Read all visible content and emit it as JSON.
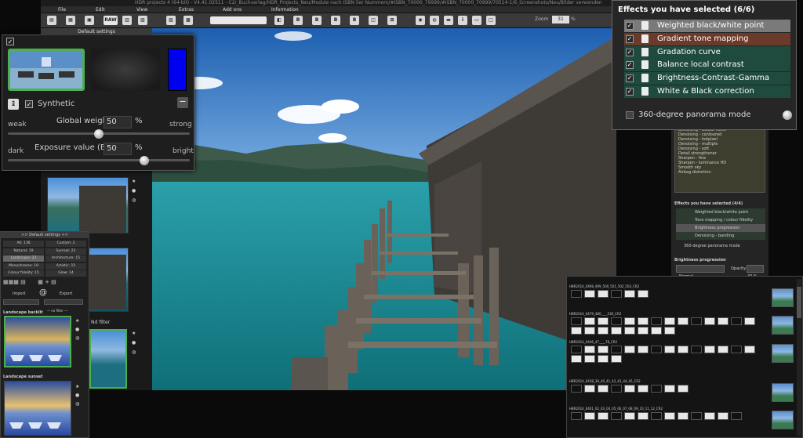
{
  "window": {
    "title": "HDR projects 4 (64-bit) - V4.41.02511 - C2/_Buchverlag/HDR_Projects_Neu/Module nach ISBN 5er Nummern/#ISBN_70000_79999/#ISBN_70000_70999/70514-1/6_Screenshots/Neu/Bilder verwenden"
  },
  "menu": {
    "file": "File",
    "edit": "Edit",
    "view": "View",
    "extras": "Extras",
    "addons": "Add ons",
    "information": "Information"
  },
  "toolbar": {
    "raw": "RAW",
    "zoom_label": "Zoom",
    "zoom_value": "31",
    "zoom_unit": "%"
  },
  "default_settings": {
    "header": "Default settings",
    "synthetic_label": "Synthetic",
    "global_weight": {
      "label": "Global weight",
      "value": "50",
      "unit": "%",
      "left": "weak",
      "right": "strong",
      "level": 0.5
    },
    "exposure": {
      "label": "Exposure value (EV)",
      "value": "50",
      "unit": "%",
      "left": "dark",
      "right": "bright",
      "level": 0.75
    }
  },
  "effects_panel": {
    "title": "Effects you have selected (6/6)",
    "items": [
      {
        "label": "Weighted black/white point",
        "checked": true,
        "highlight": "#7a7a7a"
      },
      {
        "label": "Gradient tone mapping",
        "checked": true,
        "highlight": "#6b3a2a"
      },
      {
        "label": "Gradation curve",
        "checked": true,
        "highlight": "#1f4a3e"
      },
      {
        "label": "Balance local contrast",
        "checked": true,
        "highlight": "#1f4a3e"
      },
      {
        "label": "Brightness-Contrast-Gamma",
        "checked": true,
        "highlight": "#1f4a3e"
      },
      {
        "label": "White & Black correction",
        "checked": true,
        "highlight": "#1f4a3e"
      }
    ],
    "panorama_label": "360-degree panorama mode"
  },
  "right_list": {
    "items": [
      "Denoising - Colour noise",
      "Denoising - contoured",
      "Denoising - hotpixel",
      "Denoising - multiple",
      "Denoising - soft",
      "Detail strengthener",
      "Sharpen - fine",
      "Sharpen - luminance HD",
      "Smooth sky",
      "Airbag distortion"
    ],
    "effects_title": "Effects you have selected (4/4)",
    "effects": [
      "Weighted black/white point",
      "Tone mapping / colour fidelity",
      "Brightness progression",
      "Denoising - banding"
    ],
    "panorama": "360-degree panorama mode",
    "progression_title": "Brightness progression",
    "mode": "Normal",
    "opacity_label": "Opacity",
    "opacity_value": "40 %"
  },
  "mini_panel": {
    "header": ">> Default settings <<",
    "categories": [
      [
        "All: 136",
        "Custom: 2"
      ],
      [
        "Natural: 19",
        "Surreal: 22"
      ],
      [
        "Landscape: 23",
        "Architecture: 15"
      ],
      [
        "Monochrome: 19",
        "Artistic: 15"
      ],
      [
        "Colour fidelity: 15",
        "Glow: 14"
      ]
    ],
    "import": "Import",
    "export": "Export",
    "filter": "— no filter —",
    "preset1": "Landscape backlit",
    "preset2": "Landscape sunset",
    "side_label": "Nd filter"
  },
  "filmstrip": {
    "rows": [
      "HBR2014_0498_499_500_501_502_503_CR2",
      "HBR2014_0479_480____530_CR2",
      "HBR2014_0446_47____78_CR2",
      "HBR2014_0438_39_40_41_42_43_44_45_CR2",
      "HBR2014_0401_02_03_04_05_06_07_08_09_10_11_12_CR2"
    ]
  },
  "colors": {
    "accent_green": "#4caf50",
    "blue_swatch": "#0000f0"
  }
}
